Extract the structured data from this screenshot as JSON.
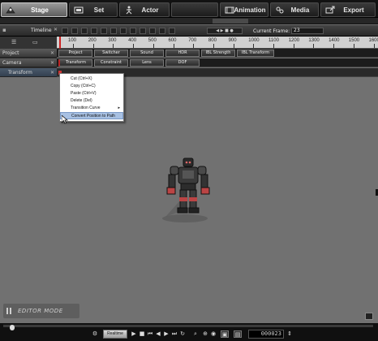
{
  "tabs": [
    {
      "label": "Stage",
      "active": true
    },
    {
      "label": "Set",
      "active": false
    },
    {
      "label": "Actor",
      "active": false
    },
    {
      "label": "",
      "active": false
    },
    {
      "label": "Animation",
      "active": false
    },
    {
      "label": "Media",
      "active": false
    },
    {
      "label": "Export",
      "active": false
    }
  ],
  "timeline": {
    "title": "Timeline",
    "current_frame_label": "Current Frame:",
    "current_frame_value": "23"
  },
  "ruler_ticks": [
    "100",
    "200",
    "300",
    "400",
    "500",
    "600",
    "700",
    "800",
    "900",
    "1000",
    "1100",
    "1200",
    "1300",
    "1400",
    "1500",
    "1600"
  ],
  "left_panel": [
    {
      "label": "Project"
    },
    {
      "label": "Camera"
    },
    {
      "label": "Transform"
    }
  ],
  "project_track": [
    "Project",
    "Switcher",
    "Sound",
    "HDR",
    "IBL Strength",
    "IBL Transform"
  ],
  "camera_track": [
    "Transform",
    "Constraint",
    "Lens",
    "DOF"
  ],
  "context_menu": [
    {
      "label": "Cut (Ctrl+X)"
    },
    {
      "label": "Copy (Ctrl+C)"
    },
    {
      "label": "Paste (Ctrl+V)"
    },
    {
      "label": "Delete (Del)"
    },
    {
      "label": "Transition Curve",
      "submenu": true
    },
    {
      "label": "Convert Position to Path",
      "hover": true
    }
  ],
  "viewport": {
    "mode_label": "EDITOR MODE"
  },
  "playback": {
    "realtime_label": "Realtime",
    "frame_counter": "000023"
  },
  "colors": {
    "viewport_bg": "#717171",
    "menu_hover": "#a8c1e3",
    "active_tab": "#8a8a8a"
  }
}
